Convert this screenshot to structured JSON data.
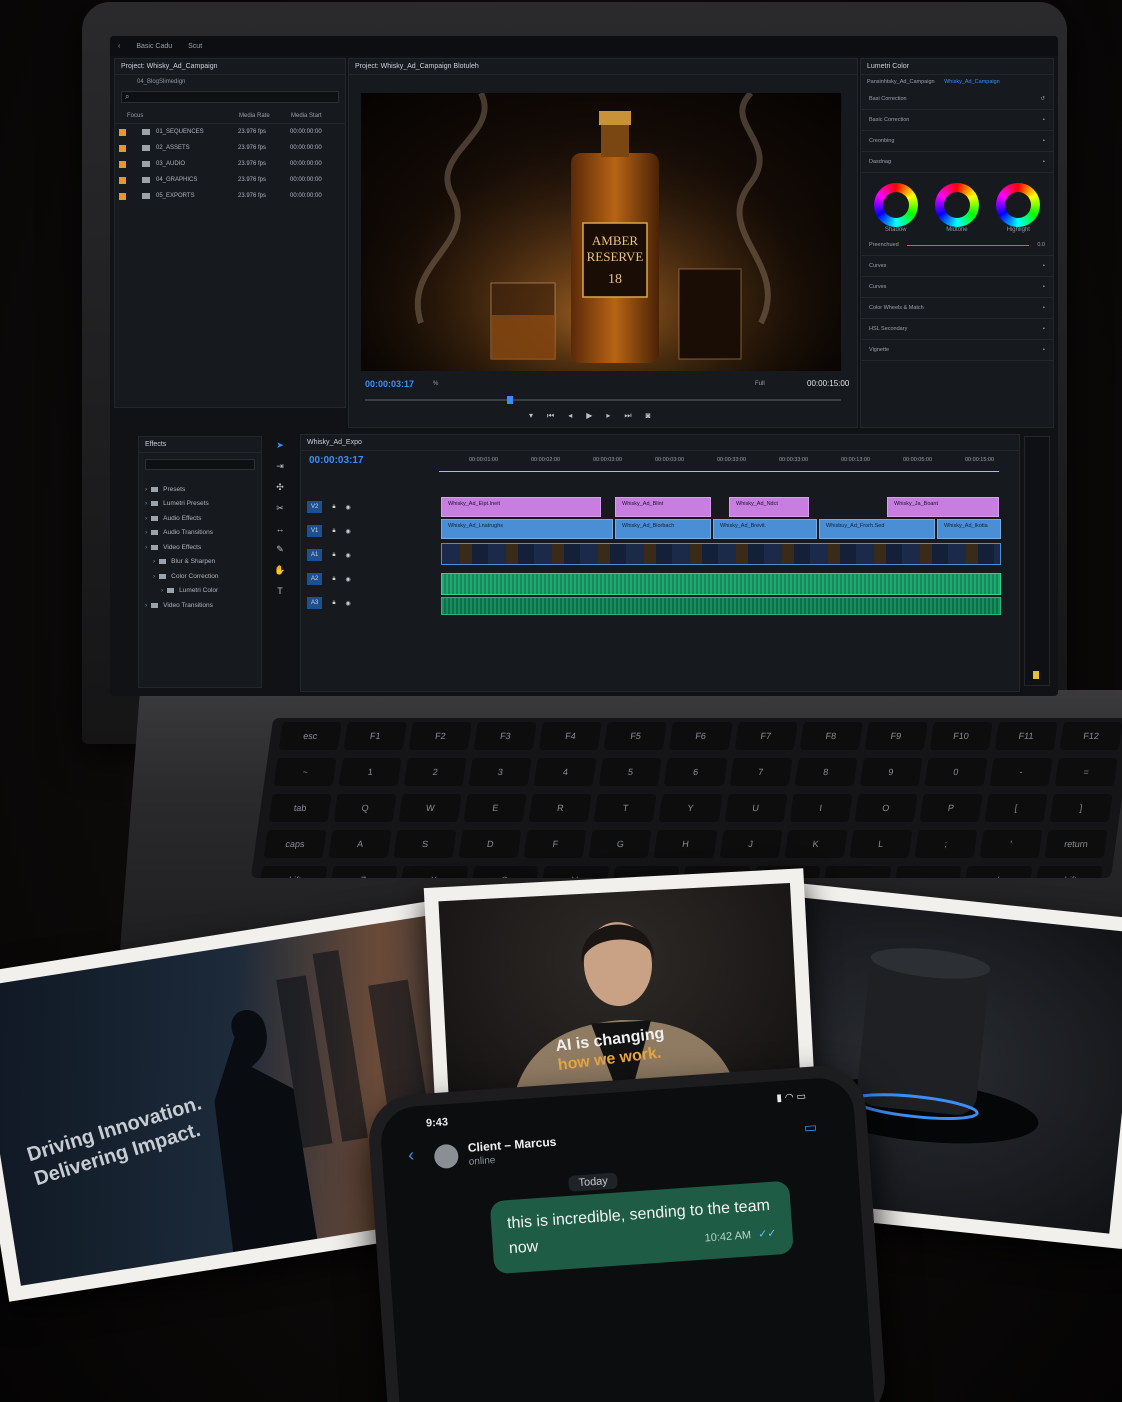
{
  "app": {
    "nav_items": [
      "Basic Cadu",
      "Scut"
    ],
    "colors": {
      "accent": "#3d8df5",
      "bin_label": "#e8952f",
      "v2_clip": "#c77ee0",
      "v1_clip": "#4a8ed6",
      "audio": "#1fa870"
    }
  },
  "project_panel": {
    "title": "Project: Whisky_Ad_Campaign",
    "path": "04_BlogSlimedign",
    "columns": [
      "Focus",
      "Media Rate",
      "Media Start"
    ],
    "rows": [
      {
        "name": "01_SEQUENCES",
        "rate": "23.976 fps",
        "start": "00:00:00:00"
      },
      {
        "name": "02_ASSETS",
        "rate": "23.976 fps",
        "start": "00:00:00:00"
      },
      {
        "name": "03_AUDIO",
        "rate": "23.976 fps",
        "start": "00:00:00:00"
      },
      {
        "name": "04_GRAPHICS",
        "rate": "23.976 fps",
        "start": "00:00:00:00"
      },
      {
        "name": "05_EXPORTS",
        "rate": "23.976 fps",
        "start": "00:00:00:00"
      }
    ]
  },
  "program_monitor": {
    "title": "Project: Whisky_Ad_Campaign Blotuleh",
    "timecode": "00:00:03:17",
    "duration": "00:00:15:00",
    "quality": "Full",
    "zoom": "%",
    "bottle_label": {
      "line1": "AMBER",
      "line2": "RESERVE",
      "line3": "18"
    }
  },
  "lumetri": {
    "title": "Lumetri Color",
    "source": "Pansinhtsky_Ad_Campaign",
    "sequence": "Whisky_Ad_Campaign",
    "section": "Basi Correction",
    "sections": [
      "Basic Correction",
      "Creonbing",
      "Dasdnag"
    ],
    "wheels": [
      "Shadow",
      "Midtone",
      "Highlight"
    ],
    "more_sections": [
      "Preenchued",
      "Curves",
      "Curves",
      "Color Wheels & Match",
      "HSL Secondary",
      "Vignette"
    ],
    "slider_value": "0.0"
  },
  "effects_panel": {
    "title": "Effects",
    "items": [
      "Presets",
      "Lumetri Presets",
      "Audio Effects",
      "Audio Transitions",
      "Video Effects",
      "Blur & Sharpen",
      "Color Correction",
      "Lumetri Color",
      "Video Transitions"
    ]
  },
  "timeline": {
    "title": "Whisky_Ad_Expo",
    "timecode": "00:00:03:17",
    "ruler": [
      "00:00:01:00",
      "00:00:02:00",
      "00:00:03:00",
      "00:00:03:00",
      "00:00:33:00",
      "00:00:33:00",
      "00:00:13:00",
      "00:00:05:00",
      "00:00:15:00"
    ],
    "track_labels": [
      "V2",
      "V1",
      "A1",
      "A2",
      "A3"
    ],
    "v2_clips": [
      "Whisky_Ad_Eipt.Ineit",
      "Whisky_Ad_Blint",
      "Whisky_Ad_Ndct",
      "Whisky_Ja_Boant"
    ],
    "v1_clips": [
      "Whisky_Ad_Lnatrughs",
      "Whisky_Ad_Biorbach",
      "Whisky_Ad_Brevit.",
      "Whisbuy_Ad_Frorh.Sed",
      "Whisky_Ad_Ikotia"
    ]
  },
  "keyboard_rows": [
    [
      "esc",
      "F1",
      "F2",
      "F3",
      "F4",
      "F5",
      "F6",
      "F7",
      "F8",
      "F9",
      "F10",
      "F11",
      "F12"
    ],
    [
      "~",
      "1",
      "2",
      "3",
      "4",
      "5",
      "6",
      "7",
      "8",
      "9",
      "0",
      "-",
      "="
    ],
    [
      "tab",
      "Q",
      "W",
      "E",
      "R",
      "T",
      "Y",
      "U",
      "I",
      "O",
      "P",
      "[",
      "]"
    ],
    [
      "caps",
      "A",
      "S",
      "D",
      "F",
      "G",
      "H",
      "J",
      "K",
      "L",
      ";",
      "'",
      "return"
    ],
    [
      "shift",
      "Z",
      "X",
      "C",
      "V",
      "B",
      "N",
      "M",
      ",",
      ".",
      "/",
      "shift"
    ]
  ],
  "photos": {
    "left_text_line1": "Driving Innovation.",
    "left_text_line2": "Delivering Impact.",
    "middle_text_line1": "AI is changing",
    "middle_text_line2": "how we work."
  },
  "phone": {
    "time": "9:43",
    "contact": "Client – Marcus",
    "status": "online",
    "date_chip": "Today",
    "message": "this is incredible, sending to the team now",
    "message_time": "10:42 AM"
  }
}
